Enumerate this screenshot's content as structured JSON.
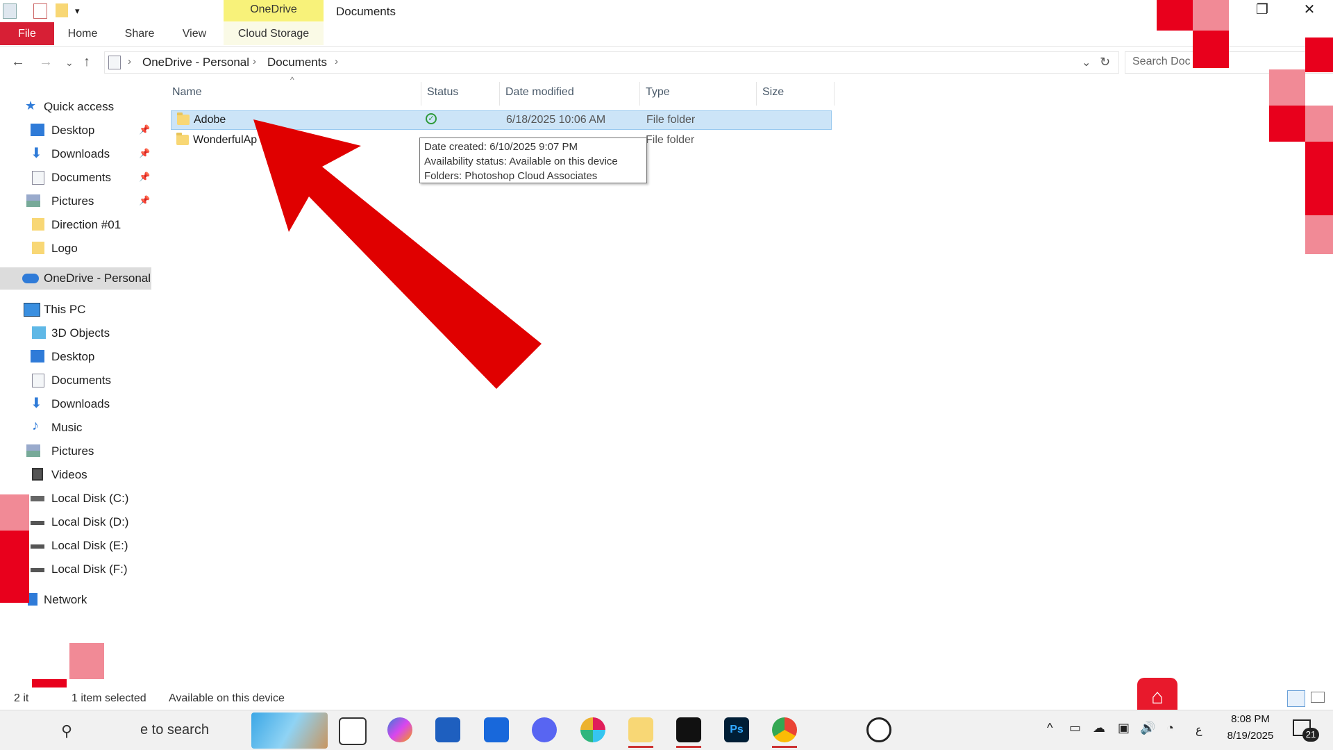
{
  "window": {
    "title": "Documents",
    "context_tab_group": "OneDrive"
  },
  "ribbon": {
    "tabs": [
      "File",
      "Home",
      "Share",
      "View",
      "Cloud Storage"
    ]
  },
  "address": {
    "crumbs": [
      "OneDrive - Personal",
      "Documents"
    ],
    "search_placeholder": "Search Doc"
  },
  "nav": {
    "quick_access": "Quick access",
    "quick_items": [
      "Desktop",
      "Downloads",
      "Documents",
      "Pictures",
      "Direction #01",
      "Logo"
    ],
    "onedrive": "OneDrive - Personal",
    "this_pc": "This PC",
    "pc_items": [
      "3D Objects",
      "Desktop",
      "Documents",
      "Downloads",
      "Music",
      "Pictures",
      "Videos",
      "Local Disk (C:)",
      "Local Disk (D:)",
      "Local Disk (E:)",
      "Local Disk (F:)"
    ],
    "network": "Network"
  },
  "columns": {
    "name": "Name",
    "status": "Status",
    "date": "Date modified",
    "type": "Type",
    "size": "Size"
  },
  "files": [
    {
      "name": "Adobe",
      "date": "6/18/2025 10:06 AM",
      "type": "File folder",
      "selected": true
    },
    {
      "name": "WonderfulAp",
      "date": "",
      "type": "File folder",
      "selected": false
    }
  ],
  "tooltip": {
    "line1": "Date created: 6/10/2025 9:07 PM",
    "line2": "Availability status: Available on this device",
    "line3": "Folders: Photoshop Cloud Associates"
  },
  "statusbar": {
    "count": "2 it",
    "selected": "1 item selected",
    "availability": "Available on this device"
  },
  "taskbar": {
    "search_text": "e to search",
    "time": "8:08 PM",
    "date": "8/19/2025",
    "notifications": "21",
    "lang": "ع"
  },
  "colors": {
    "file_tab": "#d71f35",
    "context_tab": "#f8f27a",
    "selection": "#cce4f7",
    "arrow": "#e00000"
  }
}
